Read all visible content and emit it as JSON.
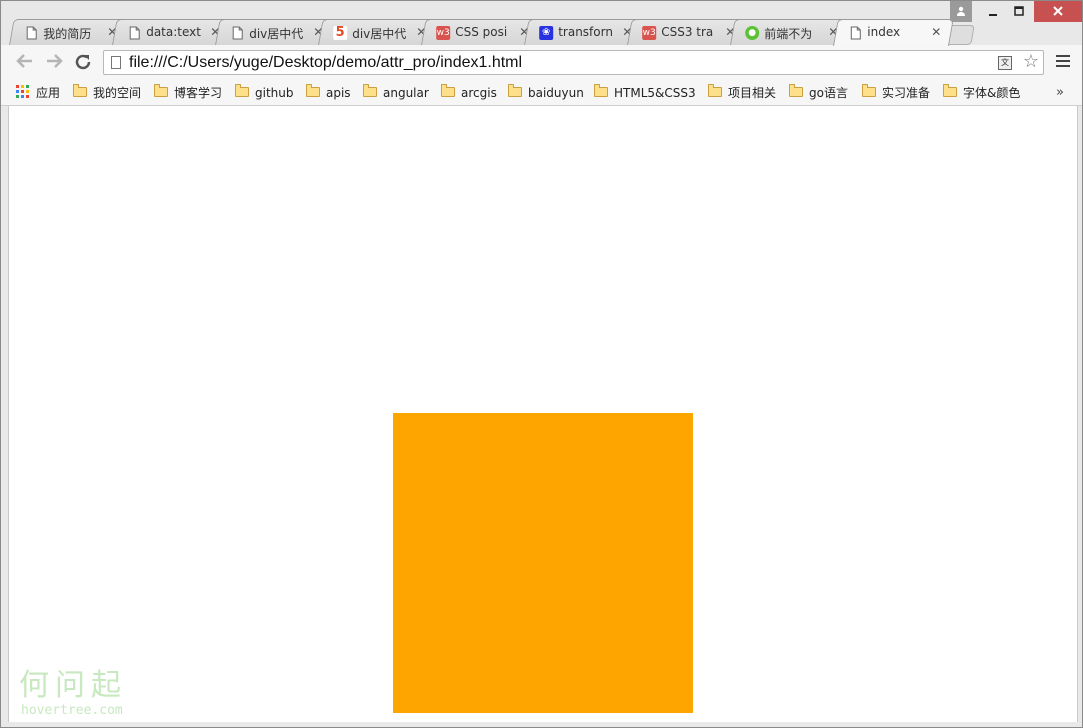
{
  "tabs": [
    {
      "title": "我的简历",
      "icon": "page-icon",
      "active": false
    },
    {
      "title": "data:text",
      "icon": "page-icon",
      "active": false
    },
    {
      "title": "div居中代",
      "icon": "page-icon",
      "active": false
    },
    {
      "title": "div居中代",
      "icon": "html5-icon",
      "active": false
    },
    {
      "title": "CSS posi",
      "icon": "w3-icon",
      "active": false
    },
    {
      "title": "transforn",
      "icon": "baidu-paw-icon",
      "active": false
    },
    {
      "title": "CSS3 tra",
      "icon": "w3-icon",
      "active": false
    },
    {
      "title": "前端不为",
      "icon": "wechat-icon",
      "active": false
    },
    {
      "title": "index",
      "icon": "page-icon",
      "active": true
    }
  ],
  "address_bar": {
    "url": "file:///C:/Users/yuge/Desktop/demo/attr_pro/index1.html"
  },
  "bookmarks": {
    "apps_label": "应用",
    "items": [
      "我的空间",
      "博客学习",
      "github",
      "apis",
      "angular",
      "arcgis",
      "baiduyun",
      "HTML5&CSS3",
      "项目相关",
      "go语言",
      "实习准备",
      "字体&颜色"
    ],
    "more_label": "»"
  },
  "page": {
    "box_color": "#FFA500"
  },
  "watermark": {
    "cn": "何问起",
    "en": "hovertree.com"
  },
  "colors": {
    "close_button": "#c75050",
    "html5": "#e34c26",
    "w3": "#d9534f",
    "baidu": "#2932e1",
    "wechat": "#5bc236"
  }
}
